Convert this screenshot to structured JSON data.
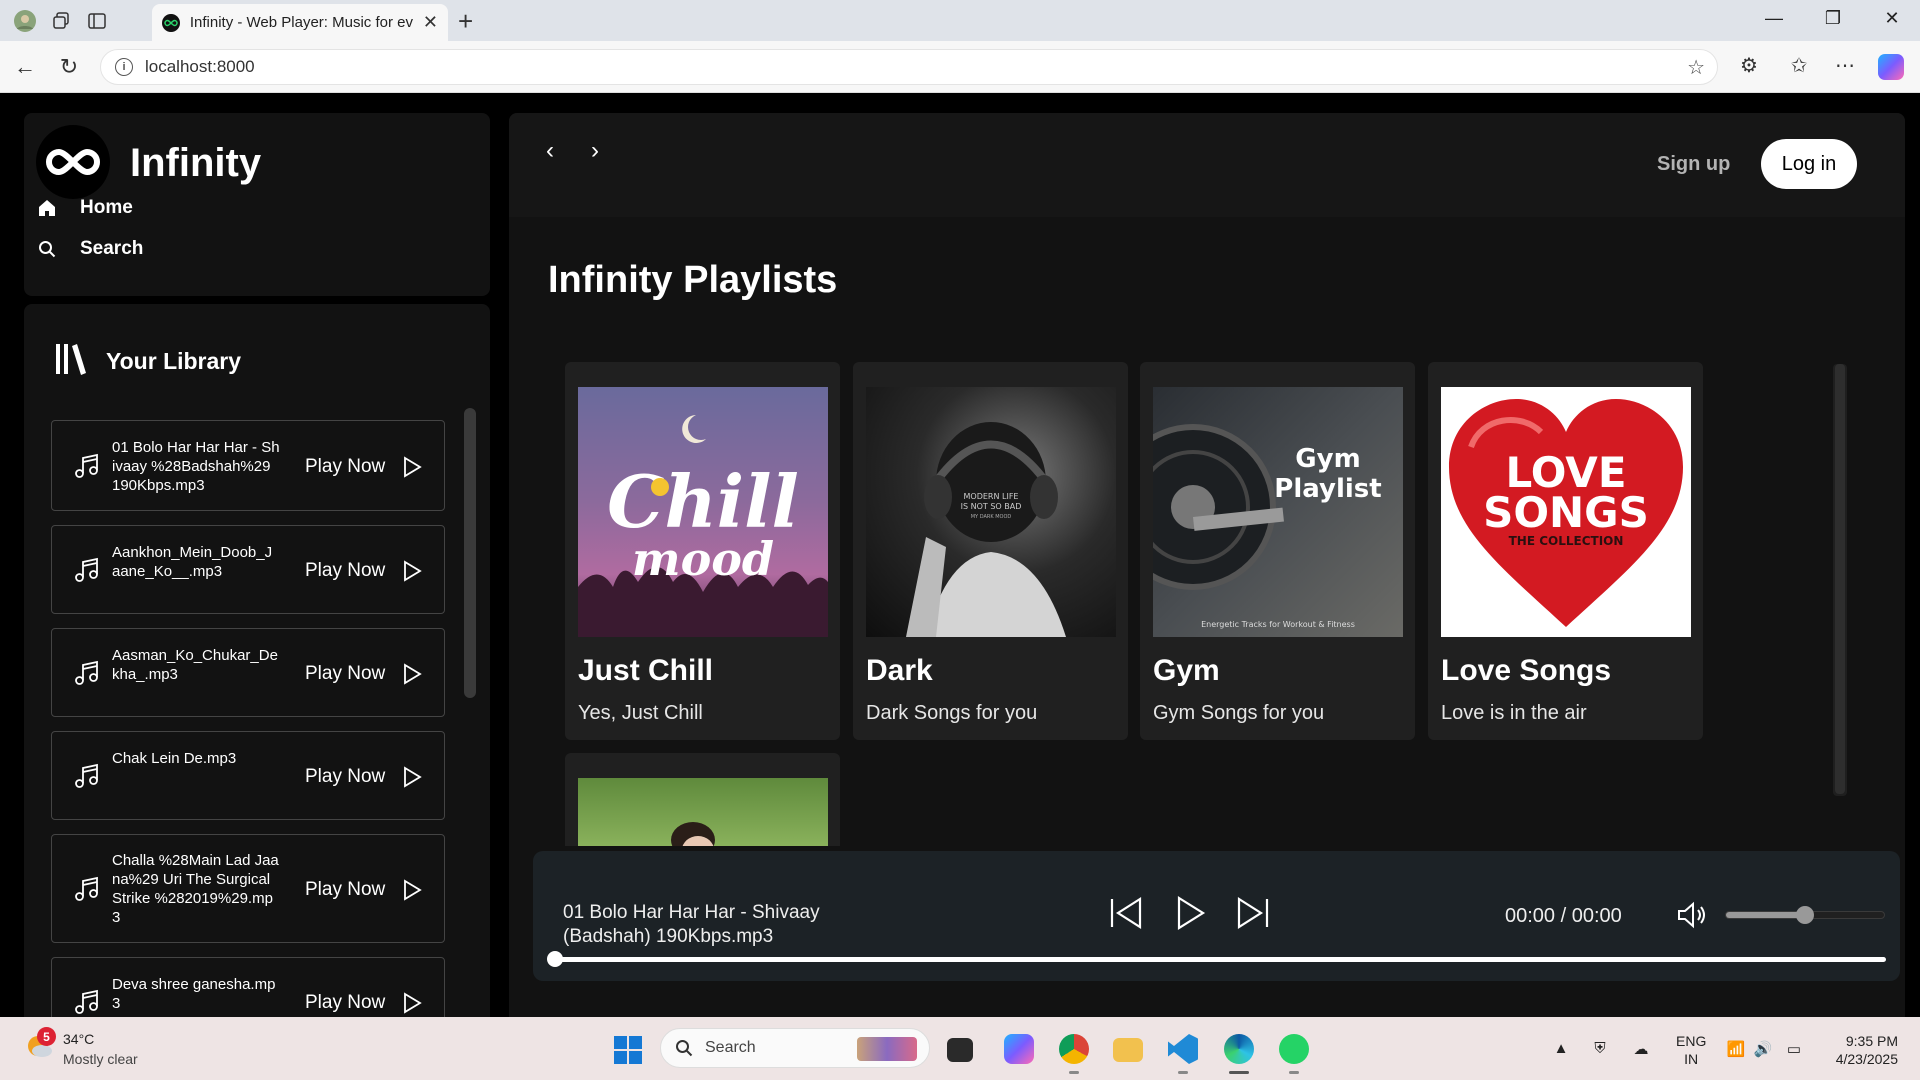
{
  "browser": {
    "tab_title": "Infinity - Web Player: Music for everyone",
    "url": "localhost:8000"
  },
  "sidebar": {
    "brand": "Infinity",
    "nav": [
      {
        "label": "Home",
        "icon": "home-icon"
      },
      {
        "label": "Search",
        "icon": "search-icon"
      }
    ],
    "library_title": "Your Library",
    "songs": [
      {
        "name": "01 Bolo Har Har Har - Shivaay %28Badshah%29 190Kbps.mp3",
        "action": "Play Now"
      },
      {
        "name": "Aankhon_Mein_Doob_Jaane_Ko__.mp3",
        "action": "Play Now"
      },
      {
        "name": "Aasman_Ko_Chukar_Dekha_.mp3",
        "action": "Play Now"
      },
      {
        "name": "Chak Lein De.mp3",
        "action": "Play Now"
      },
      {
        "name": "Challa %28Main Lad Jaana%29 Uri The Surgical Strike %282019%29.mp3",
        "action": "Play Now"
      },
      {
        "name": "Deva shree ganesha.mp3",
        "action": "Play Now"
      }
    ]
  },
  "header": {
    "signup_label": "Sign up",
    "login_label": "Log in"
  },
  "main": {
    "section_title": "Infinity Playlists",
    "playlists": [
      {
        "title": "Just Chill",
        "description": "Yes, Just Chill",
        "cover_text": [
          "Chill",
          "mood"
        ]
      },
      {
        "title": "Dark",
        "description": "Dark Songs for you",
        "cover_text": [
          "MODERN LIFE",
          "IS NOT SO BAD",
          "MY DARK MOOD"
        ]
      },
      {
        "title": "Gym",
        "description": "Gym Songs for you",
        "cover_text": [
          "Gym",
          "Playlist",
          "Energetic Tracks for Workout & Fitness"
        ]
      },
      {
        "title": "Love Songs",
        "description": "Love is in the air",
        "cover_text": [
          "LOVE",
          "SONGS",
          "THE COLLECTION"
        ]
      }
    ]
  },
  "player": {
    "now_playing": "01 Bolo Har Har Har - Shivaay (Badshah) 190Kbps.mp3",
    "time": "00:00 / 00:00",
    "volume": 0.5,
    "progress": 0
  },
  "taskbar": {
    "weather_badge": "5",
    "temperature": "34°C",
    "condition": "Mostly clear",
    "search_label": "Search",
    "lang_line1": "ENG",
    "lang_line2": "IN",
    "time": "9:35 PM",
    "date": "4/23/2025"
  },
  "colors": {
    "background": "#000000",
    "panel": "#121212",
    "card": "#202020",
    "player": "#1c2226"
  }
}
